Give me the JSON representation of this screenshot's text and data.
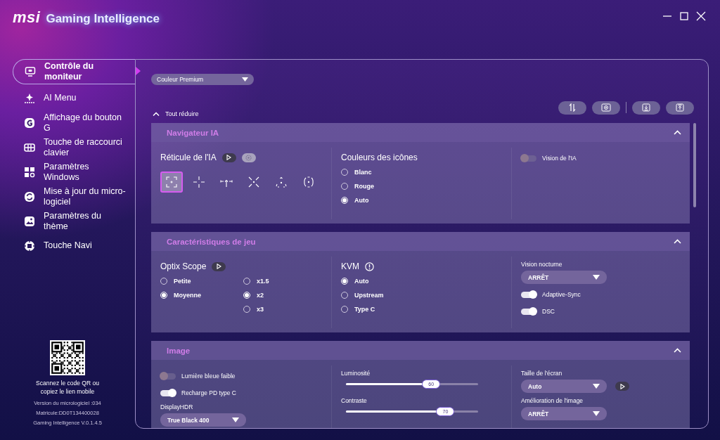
{
  "app": {
    "brand": "msi",
    "title": "Gaming Intelligence"
  },
  "sidebar": {
    "items": [
      {
        "label": "Contrôle du moniteur",
        "selected": true
      },
      {
        "label": "AI Menu",
        "selected": false
      },
      {
        "label": "Affichage du bouton G",
        "selected": false
      },
      {
        "label": "Touche de raccourci clavier",
        "selected": false
      },
      {
        "label": "Paramètres Windows",
        "selected": false
      },
      {
        "label": "Mise à jour du micro-logiciel",
        "selected": false
      },
      {
        "label": "Paramètres du thème",
        "selected": false
      },
      {
        "label": "Touche Navi",
        "selected": false
      }
    ],
    "qr_caption": "Scannez le code QR ou copiez le lien mobile",
    "version_info": [
      "Version du micrologiciel :034",
      "Matricule:DD0T134400028",
      "Gaming Intelligence V.0.1.4.5"
    ]
  },
  "preset_dropdown": {
    "value": "Couleur Premium"
  },
  "collapse_all": {
    "label": "Tout réduire"
  },
  "sections": [
    {
      "title": "Navigateur IA",
      "expanded": true,
      "columns": [
        [
          {
            "kind": "heading",
            "label": "Réticule de l'IA",
            "play_button": true,
            "settings_button": true
          },
          {
            "kind": "reticles",
            "options": [
              {
                "selected": true
              },
              {
                "selected": false
              },
              {
                "selected": false
              },
              {
                "selected": false
              },
              {
                "selected": false
              },
              {
                "selected": false
              }
            ]
          }
        ],
        [
          {
            "kind": "heading",
            "label": "Couleurs des icônes"
          },
          {
            "kind": "radios",
            "groups": [
              {
                "options": [
                  {
                    "label": "Blanc",
                    "selected": false
                  },
                  {
                    "label": "Rouge",
                    "selected": false
                  },
                  {
                    "label": "Auto",
                    "selected": true
                  }
                ]
              }
            ]
          }
        ],
        [
          {
            "kind": "toggle",
            "label": "Vision de l'IA",
            "on": false
          }
        ]
      ]
    },
    {
      "title": "Caractéristiques de jeu",
      "expanded": true,
      "columns": [
        [
          {
            "kind": "heading",
            "label": "Optix Scope",
            "play_button": true
          },
          {
            "kind": "radios",
            "groups": [
              {
                "options": [
                  {
                    "label": "Petite",
                    "selected": false
                  },
                  {
                    "label": "Moyenne",
                    "selected": true
                  }
                ]
              },
              {
                "options": [
                  {
                    "label": "x1.5",
                    "selected": false
                  },
                  {
                    "label": "x2",
                    "selected": true
                  },
                  {
                    "label": "x3",
                    "selected": false
                  }
                ]
              }
            ]
          }
        ],
        [
          {
            "kind": "heading",
            "label": "KVM",
            "info_icon": true
          },
          {
            "kind": "radios",
            "groups": [
              {
                "options": [
                  {
                    "label": "Auto",
                    "selected": true
                  },
                  {
                    "label": "Upstream",
                    "selected": false
                  },
                  {
                    "label": "Type C",
                    "selected": false
                  }
                ]
              }
            ]
          }
        ],
        [
          {
            "kind": "dropdown",
            "label": "Vision nocturne",
            "value": "ARRÊT"
          },
          {
            "kind": "toggle",
            "label": "Adaptive-Sync",
            "on": true
          },
          {
            "kind": "toggle",
            "label": "DSC",
            "on": true
          }
        ]
      ]
    },
    {
      "title": "Image",
      "expanded": true,
      "columns": [
        [
          {
            "kind": "toggle",
            "label": "Lumière bleue faible",
            "on": false
          },
          {
            "kind": "toggle",
            "label": "Recharge PD type C",
            "on": true
          },
          {
            "kind": "dropdown",
            "label": "DisplayHDR",
            "value": "True Black 400"
          }
        ],
        [
          {
            "kind": "slider",
            "label": "Luminosité",
            "level": 0.6,
            "reading": "60"
          },
          {
            "kind": "slider",
            "label": "Contraste",
            "level": 0.7,
            "reading": "70"
          }
        ],
        [
          {
            "kind": "dropdown",
            "label": "Taille de l'écran",
            "value": "Auto",
            "play_button": true
          },
          {
            "kind": "dropdown",
            "label": "Amélioration de l'image",
            "value": "ARRÊT"
          }
        ]
      ]
    }
  ]
}
